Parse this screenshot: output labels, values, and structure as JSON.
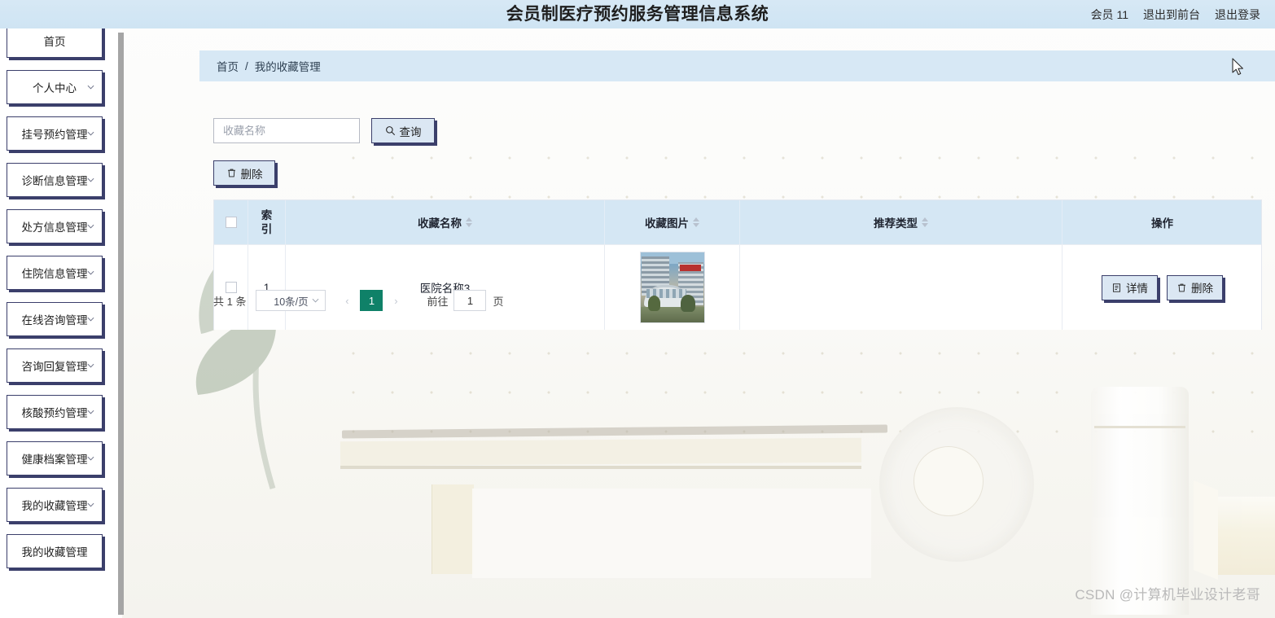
{
  "header": {
    "title": "会员制医疗预约服务管理信息系统",
    "member_label": "会员 11",
    "exit_front_label": "退出到前台",
    "logout_label": "退出登录"
  },
  "sidebar": {
    "items": [
      {
        "label": "首页",
        "has_chevron": false
      },
      {
        "label": "个人中心",
        "has_chevron": true
      },
      {
        "label": "挂号预约管理",
        "has_chevron": true
      },
      {
        "label": "诊断信息管理",
        "has_chevron": true
      },
      {
        "label": "处方信息管理",
        "has_chevron": true
      },
      {
        "label": "住院信息管理",
        "has_chevron": true
      },
      {
        "label": "在线咨询管理",
        "has_chevron": true
      },
      {
        "label": "咨询回复管理",
        "has_chevron": true
      },
      {
        "label": "核酸预约管理",
        "has_chevron": true
      },
      {
        "label": "健康档案管理",
        "has_chevron": true
      },
      {
        "label": "我的收藏管理",
        "has_chevron": true
      },
      {
        "label": "我的收藏管理",
        "has_chevron": false
      }
    ]
  },
  "breadcrumb": {
    "home": "首页",
    "separator": "/",
    "current": "我的收藏管理"
  },
  "toolbar": {
    "search_placeholder": "收藏名称",
    "search_value": "",
    "query_label": "查询",
    "delete_label": "删除"
  },
  "table": {
    "columns": [
      {
        "key": "check",
        "label": "",
        "sortable": false
      },
      {
        "key": "index",
        "label": "索引",
        "sortable": false
      },
      {
        "key": "name",
        "label": "收藏名称",
        "sortable": true
      },
      {
        "key": "image",
        "label": "收藏图片",
        "sortable": true
      },
      {
        "key": "type",
        "label": "推荐类型",
        "sortable": true
      },
      {
        "key": "ops",
        "label": "操作",
        "sortable": false
      }
    ],
    "rows": [
      {
        "index": "1",
        "name": "医院名称3",
        "image_alt": "hospital-building-photo",
        "type": "",
        "detail_label": "详情",
        "delete_label": "删除"
      }
    ]
  },
  "pagination": {
    "total_text": "共 1 条",
    "page_size": "10条/页",
    "prev_label": "‹",
    "next_label": "›",
    "current_page": "1",
    "goto_label": "前往",
    "goto_value": "1",
    "page_unit": "页"
  },
  "watermark": {
    "text": "CSDN @计算机毕业设计老哥"
  },
  "colors": {
    "header_blue": "#d7e8f5",
    "menu_border": "#3b3f6b",
    "button_fill": "#dbe7f3",
    "pager_active": "#0f8168",
    "table_head": "#d5e7f4"
  }
}
